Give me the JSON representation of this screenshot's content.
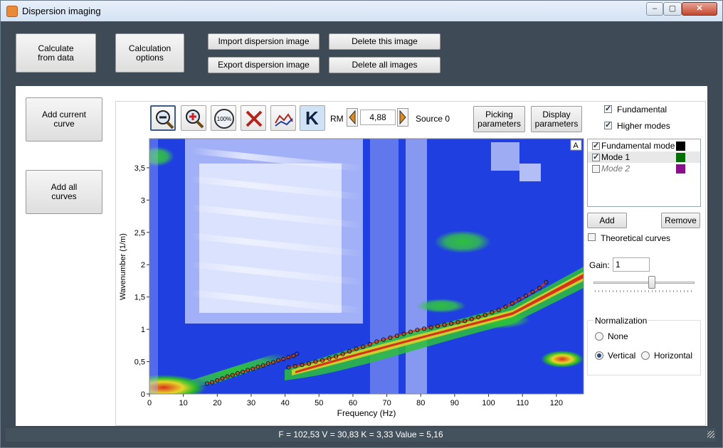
{
  "window": {
    "title": "Dispersion imaging",
    "min": "–",
    "max": "▢",
    "close": "✕"
  },
  "toolbar": {
    "calc_data": "Calculate\nfrom data",
    "calc_options": "Calculation\noptions",
    "import_img": "Import dispersion image",
    "export_img": "Export dispersion image",
    "delete_img": "Delete this image",
    "delete_all": "Delete all images"
  },
  "left": {
    "add_current": "Add current\ncurve",
    "add_all": "Add all\ncurves"
  },
  "plot_tools": {
    "k_label": "K",
    "rm_label": "RM",
    "rm_value": "4,88",
    "source_label": "Source 0",
    "zoom100": "100%",
    "picking_params": "Picking\nparameters",
    "display_params": "Display\nparameters"
  },
  "plot": {
    "corner_label": "A",
    "xlabel": "Frequency (Hz)",
    "ylabel": "Wavenumber (1/m)",
    "x_ticks": [
      "0",
      "10",
      "20",
      "30",
      "40",
      "50",
      "60",
      "70",
      "80",
      "90",
      "100",
      "110",
      "120"
    ],
    "y_ticks": [
      "0",
      "0,5",
      "1",
      "1,5",
      "2",
      "2,5",
      "3",
      "3,5"
    ]
  },
  "chart_data": {
    "type": "scatter",
    "title": "",
    "xlabel": "Frequency (Hz)",
    "ylabel": "Wavenumber (1/m)",
    "xlim": [
      0,
      128
    ],
    "ylim": [
      0,
      3.95
    ],
    "series": [
      {
        "x": [
          17,
          18.5,
          20,
          21.5,
          23,
          24.5,
          26,
          27.5,
          29,
          30.5,
          32,
          33.5,
          35,
          36.5,
          38,
          39.5,
          41,
          42.5,
          43.5
        ],
        "y": [
          0.16,
          0.18,
          0.21,
          0.24,
          0.27,
          0.29,
          0.32,
          0.34,
          0.37,
          0.39,
          0.42,
          0.44,
          0.47,
          0.49,
          0.52,
          0.54,
          0.57,
          0.59,
          0.62
        ],
        "color": "#d43a1a"
      },
      {
        "x": [
          41,
          43,
          45,
          47,
          49,
          51,
          53,
          55,
          57,
          59,
          61,
          63,
          65,
          67,
          69,
          71,
          73,
          75,
          77,
          79,
          81,
          83,
          85,
          87,
          89,
          91,
          93,
          95,
          97,
          99,
          101,
          103,
          105,
          107,
          109,
          111,
          113,
          115,
          117
        ],
        "y": [
          0.41,
          0.43,
          0.45,
          0.47,
          0.5,
          0.52,
          0.55,
          0.58,
          0.62,
          0.66,
          0.7,
          0.73,
          0.77,
          0.81,
          0.84,
          0.87,
          0.9,
          0.93,
          0.96,
          0.99,
          1.01,
          1.03,
          1.05,
          1.07,
          1.09,
          1.11,
          1.13,
          1.16,
          1.19,
          1.22,
          1.26,
          1.3,
          1.35,
          1.4,
          1.46,
          1.52,
          1.58,
          1.64,
          1.73
        ],
        "color": "#d43a1a"
      }
    ]
  },
  "side": {
    "fundamental": "Fundamental",
    "higher_modes": "Higher modes",
    "modes": [
      {
        "label": "Fundamental mode",
        "color": "#000000",
        "checked": true
      },
      {
        "label": "Mode 1",
        "color": "#007000",
        "checked": true
      },
      {
        "label": "Mode 2",
        "color": "#8b0f8b",
        "checked": false
      }
    ],
    "add": "Add",
    "remove": "Remove",
    "theoretical": "Theoretical curves",
    "gain_label": "Gain:",
    "gain_value": "1",
    "gain_level": 0.58,
    "normalization": "Normalization",
    "none": "None",
    "vertical": "Vertical",
    "horizontal": "Horizontal"
  },
  "status": "F = 102,53 V = 30,83 K = 3,33 Value = 5,16"
}
